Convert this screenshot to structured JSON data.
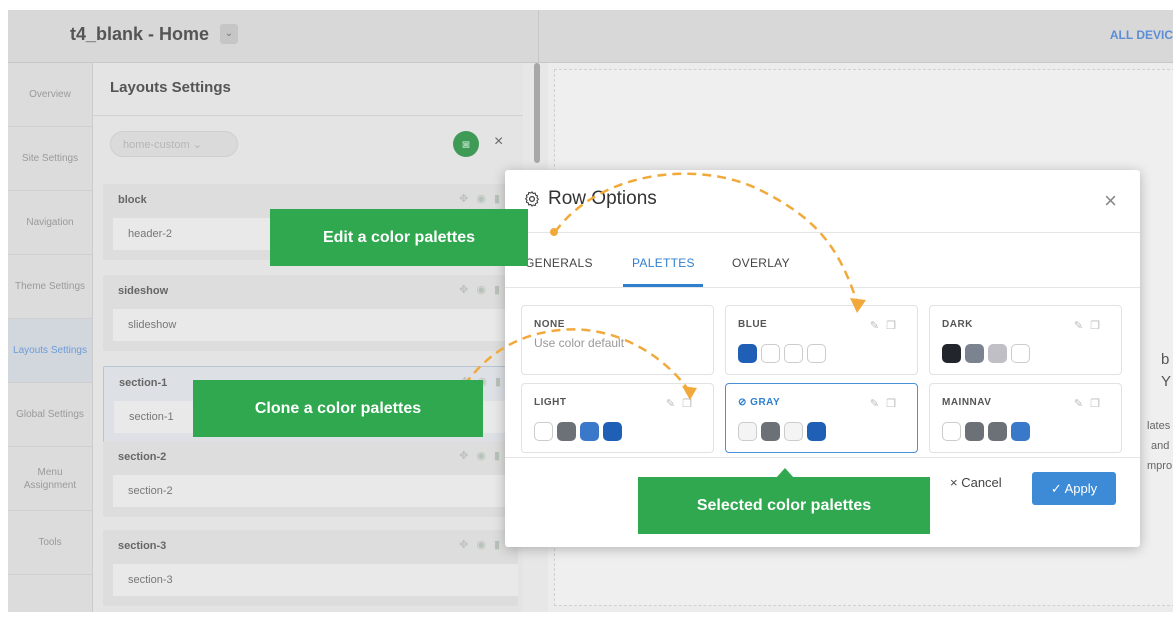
{
  "header": {
    "title": "t4_blank - Home",
    "dropdown_glyph": "⌄",
    "devices_label": "ALL DEVIC"
  },
  "nav": {
    "items": [
      {
        "label": "Overview",
        "active": false
      },
      {
        "label": "Site Settings",
        "active": false
      },
      {
        "label": "Navigation",
        "active": false
      },
      {
        "label": "Theme Settings",
        "active": false
      },
      {
        "label": "Layouts Settings",
        "active": true
      },
      {
        "label": "Global Settings",
        "active": false
      },
      {
        "label": "Menu Assignment",
        "active": false
      },
      {
        "label": "Tools",
        "active": false
      }
    ]
  },
  "panel": {
    "title": "Layouts Settings",
    "layout_select": "home-custom",
    "close_glyph": "×",
    "sections": [
      {
        "name": "block",
        "row": "header-2"
      },
      {
        "name": "sideshow",
        "row": "slideshow"
      },
      {
        "name": "section-1",
        "row": "section-1"
      },
      {
        "name": "section-2",
        "row": "section-2"
      },
      {
        "name": "section-3",
        "row": "section-3"
      }
    ]
  },
  "canvas": {
    "line1": "b",
    "line2": "Y",
    "line3": "lates",
    "line4": "and",
    "line5": "mpro"
  },
  "modal": {
    "title": "Row Options",
    "close_glyph": "×",
    "tabs": [
      {
        "label": "GENERALS",
        "active": false
      },
      {
        "label": "PALETTES",
        "active": true
      },
      {
        "label": "OVERLAY",
        "active": false
      }
    ],
    "palettes": [
      {
        "name": "NONE",
        "desc": "Use color default",
        "selected": false,
        "swatches": []
      },
      {
        "name": "BLUE",
        "desc": "",
        "selected": false,
        "swatches": [
          "#1f5fb5",
          "#ffffff",
          "#ffffff",
          "#ffffff"
        ]
      },
      {
        "name": "DARK",
        "desc": "",
        "selected": false,
        "swatches": [
          "#22252b",
          "#7b8390",
          "#c0bfc6",
          "#ffffff"
        ]
      },
      {
        "name": "LIGHT",
        "desc": "",
        "selected": false,
        "swatches": [
          "#ffffff",
          "#6c7178",
          "#3a78c9",
          "#1f5fb5"
        ]
      },
      {
        "name": "GRAY",
        "desc": "",
        "selected": true,
        "swatches": [
          "#f4f4f4",
          "#6c7178",
          "#f4f4f4",
          "#1f5fb5"
        ]
      },
      {
        "name": "MAINNAV",
        "desc": "",
        "selected": false,
        "swatches": [
          "#ffffff",
          "#6c7178",
          "#6c7178",
          "#3a78c9"
        ]
      }
    ],
    "cancel_label": "× Cancel",
    "apply_label": "✓ Apply"
  },
  "callouts": {
    "edit": "Edit a color palettes",
    "clone": "Clone a color palettes",
    "selected": "Selected color palettes"
  },
  "colors": {
    "accent": "#2f7fd0",
    "callout": "#2fa84f",
    "arrow": "#f2a93b"
  }
}
